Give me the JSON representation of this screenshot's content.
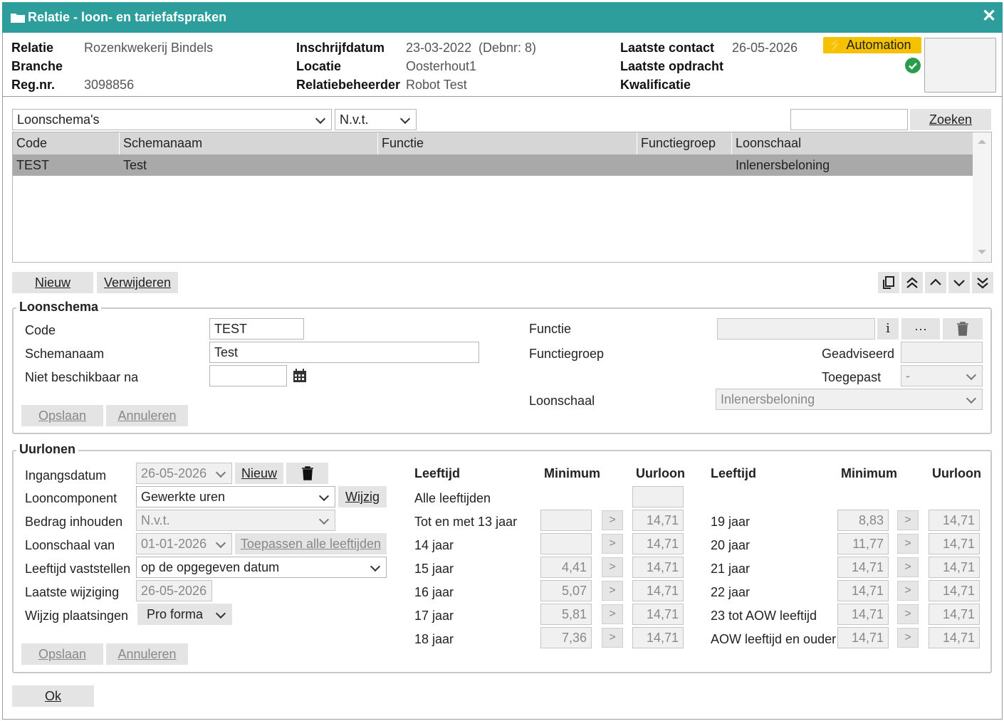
{
  "window": {
    "title": "Relatie - loon- en tariefafspraken",
    "close": "✕"
  },
  "header": {
    "relatie_label": "Relatie",
    "relatie_value": "Rozenkwekerij Bindels",
    "branche_label": "Branche",
    "regnr_label": "Reg.nr.",
    "regnr_value": "3098856",
    "inschrijf_label": "Inschrijfdatum",
    "inschrijf_value": "23-03-2022",
    "debnr": "(Debnr: 8)",
    "locatie_label": "Locatie",
    "locatie_value": "Oosterhout1",
    "beheerder_label": "Relatiebeheerder",
    "beheerder_value": "Robot Test",
    "contact_label": "Laatste contact",
    "contact_value": "26-05-2026",
    "opdracht_label": "Laatste opdracht",
    "kwalificatie_label": "Kwalificatie",
    "badge": "Automation",
    "badge_color": "#f5c200"
  },
  "filter": {
    "type": "Loonschema's",
    "scope": "N.v.t.",
    "search": "",
    "search_button": "Zoeken"
  },
  "table": {
    "columns": [
      "Code",
      "Schemanaam",
      "Functie",
      "Functiegroep",
      "Loonschaal"
    ],
    "rows": [
      {
        "code": "TEST",
        "naam": "Test",
        "functie": "",
        "functiegroep": "",
        "loonschaal": "Inlenersbeloning"
      }
    ]
  },
  "actions": {
    "new": "Nieuw",
    "delete": "Verwijderen"
  },
  "loonschema": {
    "legend": "Loonschema",
    "code_label": "Code",
    "code_value": "TEST",
    "naam_label": "Schemanaam",
    "naam_value": "Test",
    "nb_label": "Niet beschikbaar na",
    "nb_value": "",
    "functie_label": "Functie",
    "functiegroep_label": "Functiegroep",
    "geadviseerd_label": "Geadviseerd",
    "toegepast_label": "Toegepast",
    "toegepast_value": "-",
    "loonschaal_label": "Loonschaal",
    "loonschaal_value": "Inlenersbeloning",
    "save": "Opslaan",
    "cancel": "Annuleren",
    "info": "i",
    "more": "···"
  },
  "uurlonen": {
    "legend": "Uurlonen",
    "ingang_label": "Ingangsdatum",
    "ingang_value": "26-05-2026",
    "new": "Nieuw",
    "comp_label": "Looncomponent",
    "comp_value": "Gewerkte uren",
    "change": "Wijzig",
    "bedrag_label": "Bedrag inhouden",
    "bedrag_value": "N.v.t.",
    "schaal_label": "Loonschaal van",
    "schaal_value": "01-01-2026",
    "apply_all": "Toepassen alle leeftijden",
    "leeftijd_label": "Leeftijd vaststellen",
    "leeftijd_value": "op de opgegeven datum",
    "wijz_label": "Laatste wijziging",
    "wijz_value": "26-05-2026",
    "plaats_label": "Wijzig plaatsingen",
    "plaats_value": "Pro forma",
    "save": "Opslaan",
    "cancel": "Annuleren",
    "col_age": "Leeftijd",
    "col_min": "Minimum",
    "col_wage": "Uurloon",
    "alle": "Alle leeftijden",
    "left": [
      {
        "age": "Tot en met 13 jaar",
        "min": "",
        "wage": "14,71"
      },
      {
        "age": "14 jaar",
        "min": "",
        "wage": "14,71"
      },
      {
        "age": "15 jaar",
        "min": "4,41",
        "wage": "14,71"
      },
      {
        "age": "16 jaar",
        "min": "5,07",
        "wage": "14,71"
      },
      {
        "age": "17 jaar",
        "min": "5,81",
        "wage": "14,71"
      },
      {
        "age": "18 jaar",
        "min": "7,36",
        "wage": "14,71"
      }
    ],
    "right": [
      {
        "age": "19 jaar",
        "min": "8,83",
        "wage": "14,71"
      },
      {
        "age": "20 jaar",
        "min": "11,77",
        "wage": "14,71"
      },
      {
        "age": "21 jaar",
        "min": "14,71",
        "wage": "14,71"
      },
      {
        "age": "22 jaar",
        "min": "14,71",
        "wage": "14,71"
      },
      {
        "age": "23 tot AOW leeftijd",
        "min": "14,71",
        "wage": "14,71"
      },
      {
        "age": "AOW leeftijd en ouder",
        "min": "14,71",
        "wage": "14,71"
      }
    ],
    "arrow": ">"
  },
  "ok": "Ok"
}
